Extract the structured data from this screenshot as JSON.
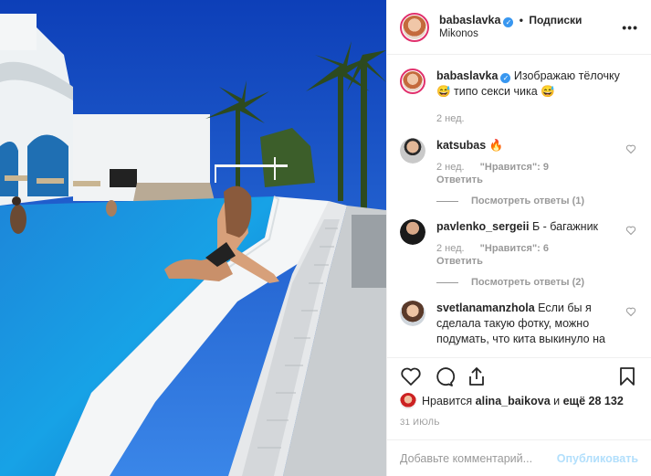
{
  "colors": {
    "accent": "#3897f0",
    "ring": "#e1306c",
    "text": "#262626",
    "muted": "#999999",
    "publish_disabled": "#b2dffc"
  },
  "header": {
    "username": "babaslavka",
    "separator": "•",
    "follow_label": "Подписки",
    "location": "Mikonos",
    "more_icon": "more-dots-icon"
  },
  "caption": {
    "username": "babaslavka",
    "text": "Изображаю тёлочку 😅 типо секси чика 😅",
    "time": "2 нед."
  },
  "comments": [
    {
      "username": "katsubas",
      "text": "🔥",
      "time": "2 нед.",
      "likes": "\"Нравится\": 9",
      "reply_label": "Ответить",
      "view_replies": "Посмотреть ответы (1)"
    },
    {
      "username": "pavlenko_sergeii",
      "text": "Б - багажник",
      "time": "2 нед.",
      "likes": "\"Нравится\": 6",
      "reply_label": "Ответить",
      "view_replies": "Посмотреть ответы (2)"
    },
    {
      "username": "svetlanamanzhola",
      "text": "Если бы я сделала такую фотку, можно подумать, что кита выкинуло на"
    }
  ],
  "likes": {
    "prefix": "Нравится",
    "user": "alina_baikova",
    "middle": "и",
    "others": "ещё 28 132"
  },
  "date": "31 ИЮЛЬ",
  "add_comment": {
    "placeholder": "Добавьте комментарий...",
    "publish_label": "Опубликовать"
  }
}
